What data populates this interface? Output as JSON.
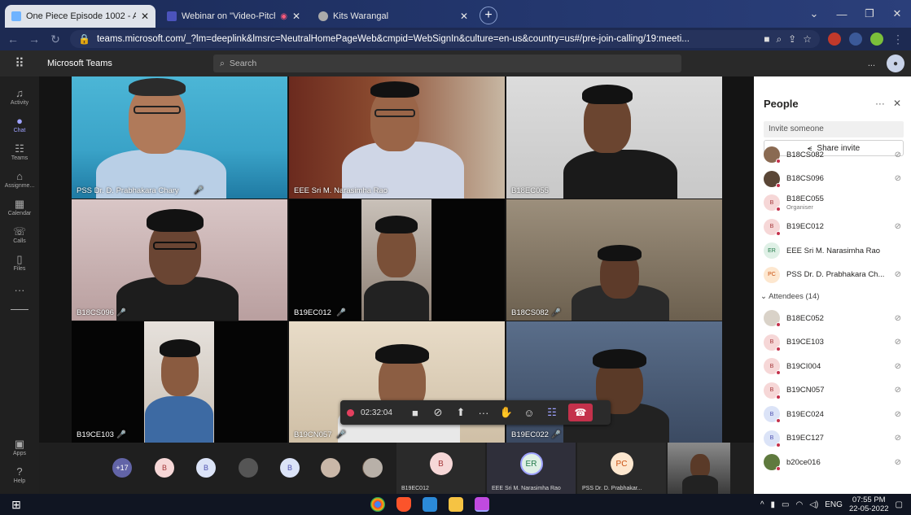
{
  "browser": {
    "tabs": [
      {
        "title": "One Piece Episode 1002 - AniMi...",
        "active": true,
        "color": "#6fb3ff"
      },
      {
        "title": "Webinar on \"Video-Pitching",
        "active": false,
        "color": "#4b53bc"
      },
      {
        "title": "Kits Warangal",
        "active": false,
        "color": "#aaaaaa"
      }
    ],
    "url": "teams.microsoft.com/_?lm=deeplink&lmsrc=NeutralHomePageWeb&cmpid=WebSignIn&culture=en-us&country=us#/pre-join-calling/19:meeti..."
  },
  "teams": {
    "app_name": "Microsoft Teams",
    "search_placeholder": "Search",
    "more": "...",
    "rail": [
      {
        "label": "Activity",
        "icon": "bell-icon",
        "glyph": "♫"
      },
      {
        "label": "Chat",
        "icon": "chat-icon",
        "glyph": "●"
      },
      {
        "label": "Teams",
        "icon": "teams-icon",
        "glyph": "☷"
      },
      {
        "label": "Assignme...",
        "icon": "assignments-icon",
        "glyph": "⌂"
      },
      {
        "label": "Calendar",
        "icon": "calendar-icon",
        "glyph": "▦"
      },
      {
        "label": "Calls",
        "icon": "calls-icon",
        "glyph": "☏"
      },
      {
        "label": "Files",
        "icon": "files-icon",
        "glyph": "▯"
      },
      {
        "label": "",
        "icon": "more-icon",
        "glyph": "···"
      }
    ],
    "rail_bottom": [
      {
        "label": "Apps",
        "icon": "apps-icon",
        "glyph": "▣"
      },
      {
        "label": "Help",
        "icon": "help-icon",
        "glyph": "?"
      }
    ]
  },
  "videos": [
    {
      "name": "PSS Dr. D. Prabhakara Chary",
      "mic": "🎤"
    },
    {
      "name": "EEE Sri M. Narasimha Rao",
      "mic": ""
    },
    {
      "name": "B18EC055",
      "mic": ""
    },
    {
      "name": "B18CS096",
      "mic": "🎤"
    },
    {
      "name": "B19EC012",
      "mic": "🎤"
    },
    {
      "name": "B18CS082",
      "mic": "🎤"
    },
    {
      "name": "B19CE103",
      "mic": "🎤"
    },
    {
      "name": "B19CN057",
      "mic": "🎤"
    },
    {
      "name": "B19EC022",
      "mic": "🎤"
    }
  ],
  "controls": {
    "timer": "02:32:04"
  },
  "filmstrip": {
    "overflow": "+17",
    "avatars": [
      "B",
      "B",
      "",
      "B",
      "",
      "",
      ""
    ],
    "tiles": [
      {
        "initials": "B",
        "name": "B19EC012"
      },
      {
        "initials": "ER",
        "name": "EEE Sri M. Narasimha Rao"
      },
      {
        "initials": "PC",
        "name": "PSS Dr. D. Prabhakar..."
      }
    ]
  },
  "people": {
    "title": "People",
    "invite_placeholder": "Invite someone",
    "share_invite": "Share invite",
    "presenters": [
      {
        "initials": "",
        "name": "B18CS082",
        "sub": "",
        "color": "#8a6a52",
        "muted": true
      },
      {
        "initials": "",
        "name": "B18CS096",
        "sub": "",
        "color": "#5a4636",
        "muted": true
      },
      {
        "initials": "B",
        "name": "B18EC055",
        "sub": "Organiser",
        "color": "#f6d7d7",
        "muted": false
      },
      {
        "initials": "B",
        "name": "B19EC012",
        "sub": "",
        "color": "#f6d7d7",
        "muted": true
      },
      {
        "initials": "ER",
        "name": "EEE Sri M. Narasimha Rao",
        "sub": "",
        "color": "#dff0e6",
        "muted": false
      },
      {
        "initials": "PC",
        "name": "PSS Dr. D. Prabhakara Ch...",
        "sub": "",
        "color": "#fde7cf",
        "muted": true
      }
    ],
    "attendees_label": "Attendees (14)",
    "attendees": [
      {
        "initials": "",
        "name": "B18EC052",
        "color": "#d9d2c8"
      },
      {
        "initials": "B",
        "name": "B19CE103",
        "color": "#f6d7d7"
      },
      {
        "initials": "B",
        "name": "B19CI004",
        "color": "#f6d7d7"
      },
      {
        "initials": "B",
        "name": "B19CN057",
        "color": "#f6d7d7"
      },
      {
        "initials": "B",
        "name": "B19EC024",
        "color": "#dbe3f7"
      },
      {
        "initials": "B",
        "name": "B19EC127",
        "color": "#dbe3f7"
      },
      {
        "initials": "",
        "name": "b20ce016",
        "color": "#5f7a3e"
      }
    ]
  },
  "taskbar": {
    "lang": "ENG",
    "time": "07:55 PM",
    "date": "22-05-2022"
  }
}
